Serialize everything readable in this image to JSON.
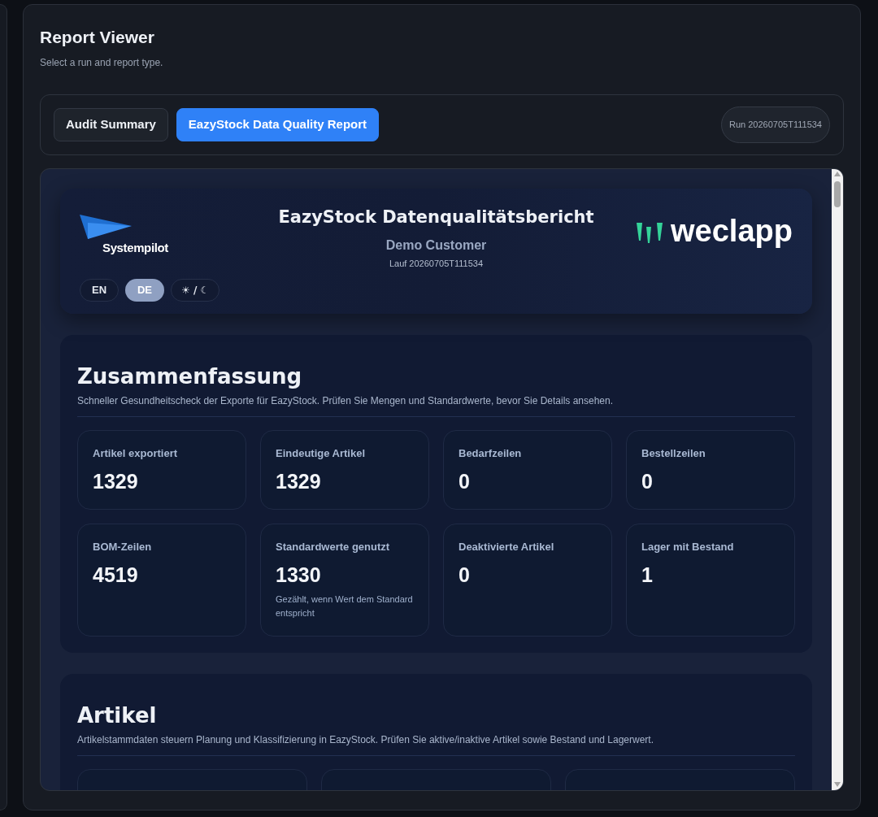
{
  "page": {
    "title": "Report Viewer",
    "subtitle": "Select a run and report type."
  },
  "tabs": [
    {
      "label": "Audit Summary",
      "selected": false
    },
    {
      "label": "EazyStock Data Quality Report",
      "selected": true
    }
  ],
  "run_badge": "Run 20260705T111534",
  "report": {
    "brand_left": "Systempilot",
    "title": "EazyStock Datenqualitätsbericht",
    "customer": "Demo Customer",
    "run": "Lauf 20260705T111534",
    "brand_right": "weclapp",
    "languages": [
      {
        "label": "EN",
        "selected": false
      },
      {
        "label": "DE",
        "selected": true
      }
    ],
    "theme_toggle": "☀ / ☾",
    "sections": [
      {
        "title": "Zusammenfassung",
        "description": "Schneller Gesundheitscheck der Exporte für EazyStock. Prüfen Sie Mengen und Standardwerte, bevor Sie Details ansehen.",
        "stats": [
          {
            "label": "Artikel exportiert",
            "value": "1329"
          },
          {
            "label": "Eindeutige Artikel",
            "value": "1329"
          },
          {
            "label": "Bedarfzeilen",
            "value": "0"
          },
          {
            "label": "Bestellzeilen",
            "value": "0"
          },
          {
            "label": "BOM-Zeilen",
            "value": "4519"
          },
          {
            "label": "Standardwerte genutzt",
            "value": "1330",
            "note": "Gezählt, wenn Wert dem Standard entspricht"
          },
          {
            "label": "Deaktivierte Artikel",
            "value": "0"
          },
          {
            "label": "Lager mit Bestand",
            "value": "1"
          }
        ]
      },
      {
        "title": "Artikel",
        "description": "Artikelstammdaten steuern Planung und Klassifizierung in EazyStock. Prüfen Sie aktive/inaktive Artikel sowie Bestand und Lagerwert."
      }
    ]
  }
}
